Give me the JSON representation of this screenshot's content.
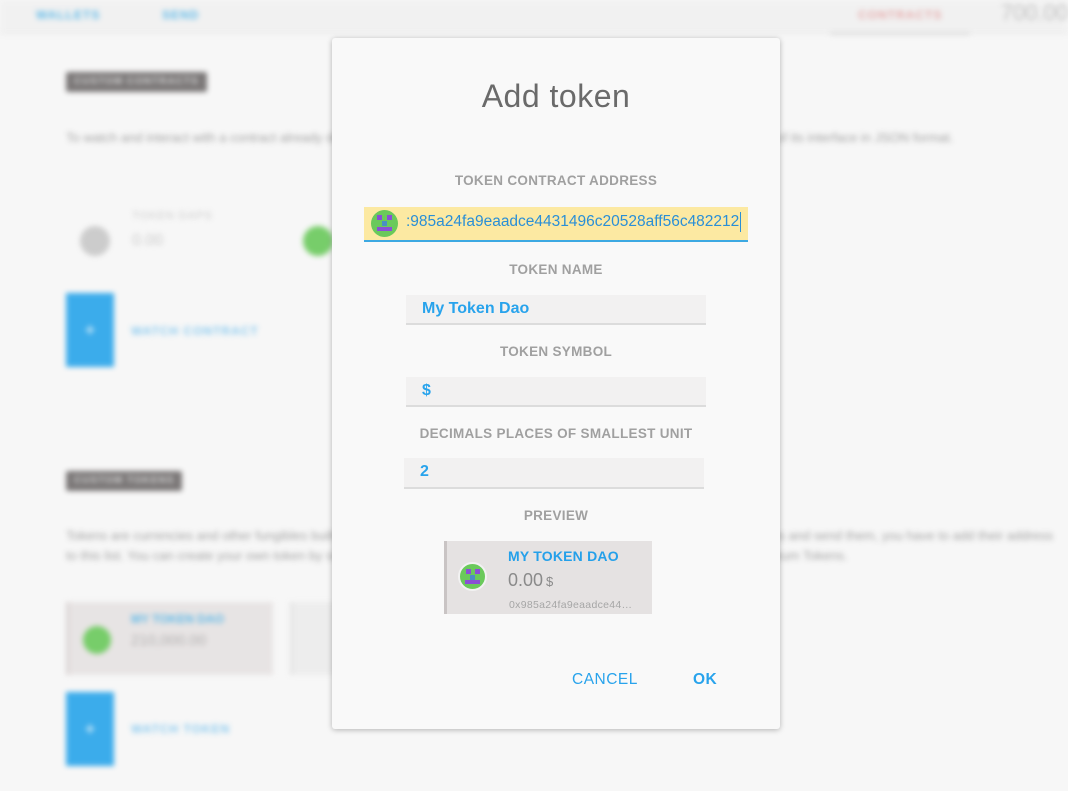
{
  "background": {
    "nav": {
      "wallets": "WALLETS",
      "send": "SEND",
      "contracts": "CONTRACTS",
      "balance": "700.00"
    },
    "custom_contracts": {
      "heading": "CUSTOM CONTRACTS",
      "description": "To watch and interact with a contract already deployed on the blockchain, you need to know its address and the description of its interface in JSON format.",
      "watch_label": "WATCH CONTRACT",
      "wallet_name": "TOKEN DAPS",
      "wallet_value": "0.00"
    },
    "custom_tokens": {
      "heading": "CUSTOM TOKENS",
      "description": "Tokens are currencies and other fungibles built on the Ethereum platform. In order for accounts to be able to watch for tokens and send them, you have to add their address to this list. You can create your own token by simply modifying this example of a custom token or learning more about Ethereum Tokens.",
      "link_text": "Ethereum Tokens",
      "watch_label": "WATCH TOKEN",
      "token_card": {
        "name": "MY TOKEN DAO",
        "value": "210,000.00"
      }
    }
  },
  "dialog": {
    "title": "Add token",
    "address_label": "TOKEN CONTRACT ADDRESS",
    "address_value": ":985a24fa9eaadce4431496c20528aff56c482212",
    "name_label": "TOKEN NAME",
    "name_value": "My Token Dao",
    "symbol_label": "TOKEN SYMBOL",
    "symbol_value": "$",
    "decimals_label": "DECIMALS PLACES OF SMALLEST UNIT",
    "decimals_value": "2",
    "preview_label": "PREVIEW",
    "preview": {
      "name": "MY TOKEN DAO",
      "balance": "0.00",
      "symbol": "$",
      "address": "0x985a24fa9eaadce44…"
    },
    "cancel_label": "CANCEL",
    "ok_label": "OK"
  },
  "colors": {
    "accent": "#28a3ec",
    "address_highlight": "#fce9a2",
    "overlay_button": "#27a4ea"
  },
  "icons": [
    "identicon"
  ]
}
